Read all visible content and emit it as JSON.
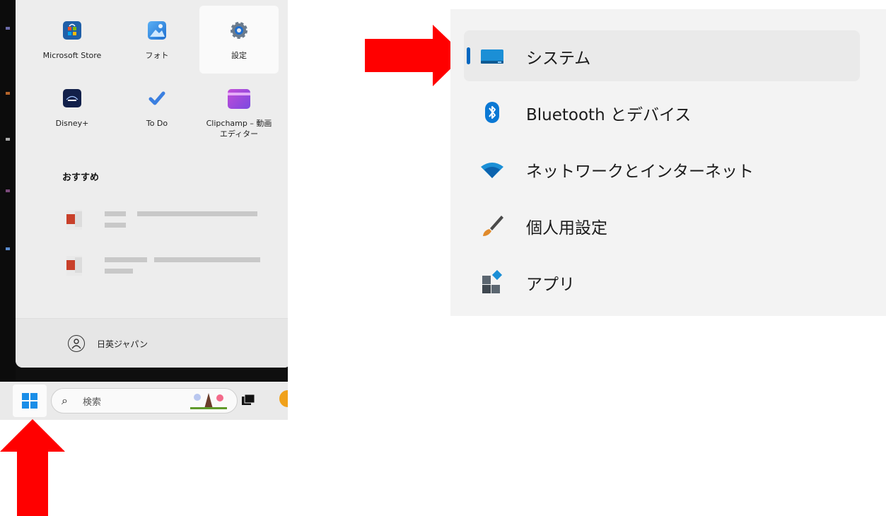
{
  "start_menu": {
    "pinned": [
      {
        "label": "Microsoft Store",
        "icon": "microsoft-store-icon"
      },
      {
        "label": "フォト",
        "icon": "photos-icon"
      },
      {
        "label": "設定",
        "icon": "settings-gear-icon"
      },
      {
        "label": "Disney+",
        "icon": "disney-plus-icon"
      },
      {
        "label": "To Do",
        "icon": "todo-check-icon"
      },
      {
        "label": "Clipchamp – 動画エディター",
        "icon": "clipchamp-icon"
      }
    ],
    "recommended_title": "おすすめ",
    "user_name": "日英ジャパン"
  },
  "taskbar": {
    "search_text": "検索",
    "icons": [
      "windows-start-icon",
      "search-icon",
      "task-view-icon"
    ]
  },
  "settings_nav": {
    "items": [
      {
        "label": "システム",
        "icon": "system-display-icon"
      },
      {
        "label": "Bluetooth とデバイス",
        "icon": "bluetooth-icon"
      },
      {
        "label": "ネットワークとインターネット",
        "icon": "wifi-icon"
      },
      {
        "label": "個人用設定",
        "icon": "brush-icon"
      },
      {
        "label": "アプリ",
        "icon": "apps-icon"
      }
    ],
    "selected_index": 0
  },
  "colors": {
    "arrow": "#ff0000",
    "accent": "#0067c0",
    "windows_blue": "#1a8ee8"
  }
}
